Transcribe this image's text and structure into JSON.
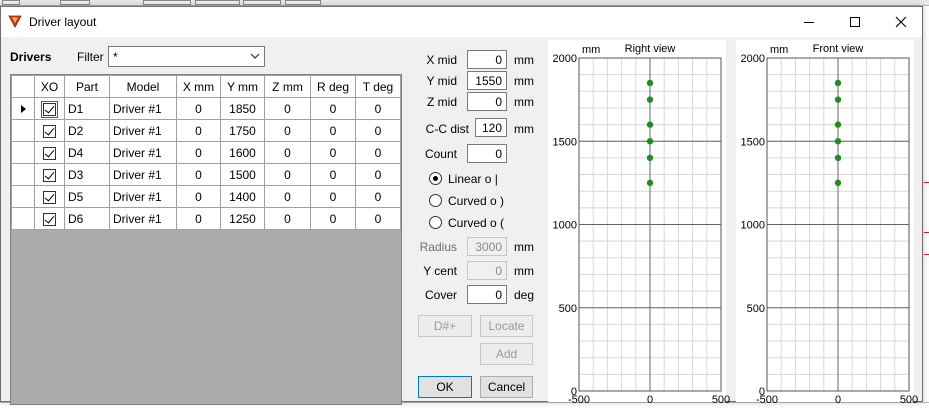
{
  "window": {
    "title": "Driver layout"
  },
  "drivers": {
    "heading": "Drivers",
    "filter_label": "Filter",
    "filter_value": "*",
    "columns": [
      "XO",
      "Part",
      "Model",
      "X mm",
      "Y mm",
      "Z mm",
      "R deg",
      "T deg"
    ],
    "rows": [
      {
        "xo": true,
        "part": "D1",
        "model": "Driver #1",
        "x": "0",
        "y": "1850",
        "z": "0",
        "r": "0",
        "t": "0"
      },
      {
        "xo": true,
        "part": "D2",
        "model": "Driver #1",
        "x": "0",
        "y": "1750",
        "z": "0",
        "r": "0",
        "t": "0"
      },
      {
        "xo": true,
        "part": "D4",
        "model": "Driver #1",
        "x": "0",
        "y": "1600",
        "z": "0",
        "r": "0",
        "t": "0"
      },
      {
        "xo": true,
        "part": "D3",
        "model": "Driver #1",
        "x": "0",
        "y": "1500",
        "z": "0",
        "r": "0",
        "t": "0"
      },
      {
        "xo": true,
        "part": "D5",
        "model": "Driver #1",
        "x": "0",
        "y": "1400",
        "z": "0",
        "r": "0",
        "t": "0"
      },
      {
        "xo": true,
        "part": "D6",
        "model": "Driver #1",
        "x": "0",
        "y": "1250",
        "z": "0",
        "r": "0",
        "t": "0"
      }
    ]
  },
  "params": {
    "x_mid": {
      "label": "X mid",
      "value": "0",
      "unit": "mm"
    },
    "y_mid": {
      "label": "Y mid",
      "value": "1550",
      "unit": "mm"
    },
    "z_mid": {
      "label": "Z mid",
      "value": "0",
      "unit": "mm"
    },
    "cc_dist": {
      "label": "C-C dist",
      "value": "120",
      "unit": "mm"
    },
    "count": {
      "label": "Count",
      "value": "0"
    },
    "arrangement": [
      {
        "label": "Linear  o  |",
        "selected": true
      },
      {
        "label": "Curved  o  )",
        "selected": false
      },
      {
        "label": "Curved  o  (",
        "selected": false
      }
    ],
    "radius": {
      "label": "Radius",
      "value": "3000",
      "unit": "mm"
    },
    "y_cent": {
      "label": "Y cent",
      "value": "0",
      "unit": "mm"
    },
    "cover": {
      "label": "Cover",
      "value": "0",
      "unit": "deg"
    }
  },
  "buttons": {
    "dnum": "D#+",
    "locate": "Locate",
    "add": "Add",
    "ok": "OK",
    "cancel": "Cancel"
  },
  "chart_data": [
    {
      "type": "scatter",
      "title": "Right view",
      "unit_label": "mm",
      "x": [
        0,
        0,
        0,
        0,
        0,
        0
      ],
      "y": [
        1850,
        1750,
        1600,
        1500,
        1400,
        1250
      ],
      "xlim": [
        -500,
        500
      ],
      "ylim": [
        0,
        2000
      ],
      "xticks": [
        "-500",
        "0",
        "500"
      ],
      "yticks": [
        "0",
        "500",
        "1000",
        "1500",
        "2000"
      ],
      "grid": true,
      "color": "#228b22"
    },
    {
      "type": "scatter",
      "title": "Front view",
      "unit_label": "mm",
      "x": [
        0,
        0,
        0,
        0,
        0,
        0
      ],
      "y": [
        1850,
        1750,
        1600,
        1500,
        1400,
        1250
      ],
      "xlim": [
        -500,
        500
      ],
      "ylim": [
        0,
        2000
      ],
      "xticks": [
        "-500",
        "0",
        "500"
      ],
      "yticks": [
        "0",
        "500",
        "1000",
        "1500",
        "2000"
      ],
      "grid": true,
      "color": "#228b22"
    }
  ]
}
